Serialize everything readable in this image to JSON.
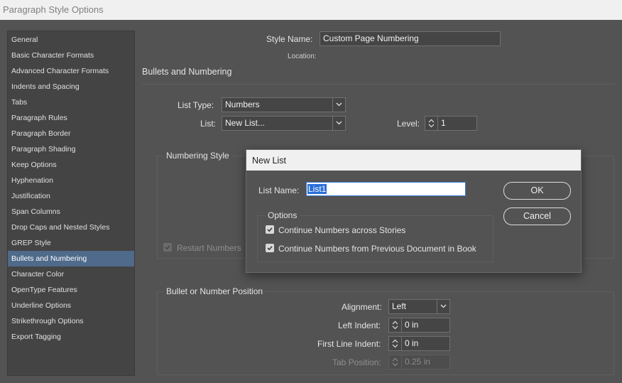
{
  "window": {
    "title": "Paragraph Style Options"
  },
  "sidebar": {
    "items": [
      {
        "label": "General"
      },
      {
        "label": "Basic Character Formats"
      },
      {
        "label": "Advanced Character Formats"
      },
      {
        "label": "Indents and Spacing"
      },
      {
        "label": "Tabs"
      },
      {
        "label": "Paragraph Rules"
      },
      {
        "label": "Paragraph Border"
      },
      {
        "label": "Paragraph Shading"
      },
      {
        "label": "Keep Options"
      },
      {
        "label": "Hyphenation"
      },
      {
        "label": "Justification"
      },
      {
        "label": "Span Columns"
      },
      {
        "label": "Drop Caps and Nested Styles"
      },
      {
        "label": "GREP Style"
      },
      {
        "label": "Bullets and Numbering"
      },
      {
        "label": "Character Color"
      },
      {
        "label": "OpenType Features"
      },
      {
        "label": "Underline Options"
      },
      {
        "label": "Strikethrough Options"
      },
      {
        "label": "Export Tagging"
      }
    ],
    "active_index": 14
  },
  "header": {
    "style_name_label": "Style Name:",
    "style_name_value": "Custom Page Numbering",
    "location_label": "Location:"
  },
  "section": {
    "title": "Bullets and Numbering"
  },
  "list": {
    "list_type_label": "List Type:",
    "list_type_value": "Numbers",
    "list_label": "List:",
    "list_value": "New List...",
    "level_label": "Level:",
    "level_value": "1"
  },
  "numbering_style": {
    "title": "Numbering Style",
    "restart_label": "Restart Numbers"
  },
  "position": {
    "title": "Bullet or Number Position",
    "alignment_label": "Alignment:",
    "alignment_value": "Left",
    "left_indent_label": "Left Indent:",
    "left_indent_value": "0 in",
    "first_line_label": "First Line Indent:",
    "first_line_value": "0 in",
    "tab_position_label": "Tab Position:",
    "tab_position_value": "0.25 in"
  },
  "new_list_dialog": {
    "title": "New List",
    "list_name_label": "List Name:",
    "list_name_value": "List1",
    "options_title": "Options",
    "opt_across_stories": "Continue Numbers across Stories",
    "opt_prev_document": "Continue Numbers from Previous Document in Book",
    "ok_label": "OK",
    "cancel_label": "Cancel"
  },
  "colors": {
    "background": "#535353",
    "sidebar_active": "#4f6a8a",
    "selection": "#2a6ed8"
  }
}
